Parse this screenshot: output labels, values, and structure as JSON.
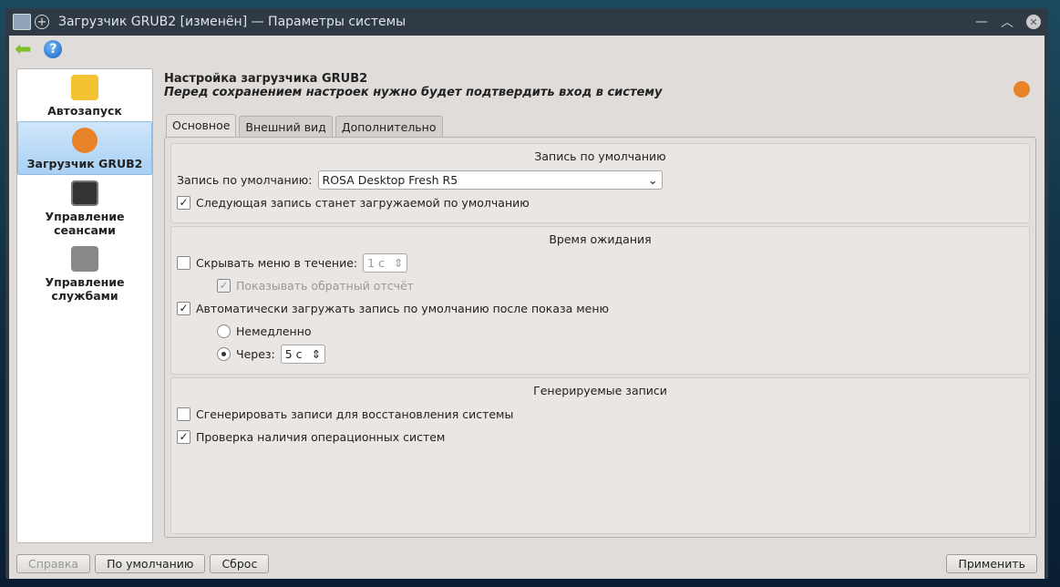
{
  "window": {
    "title": "Загрузчик GRUB2 [изменён] — Параметры системы"
  },
  "sidebar": {
    "items": [
      {
        "label": "Автозапуск"
      },
      {
        "label": "Загрузчик GRUB2"
      },
      {
        "label": "Управление сеансами"
      },
      {
        "label": "Управление службами"
      }
    ]
  },
  "header": {
    "title": "Настройка загрузчика GRUB2",
    "subtitle": "Перед сохранением настроек нужно будет подтвердить вход в систему"
  },
  "tabs": [
    "Основное",
    "Внешний вид",
    "Дополнительно"
  ],
  "default": {
    "title": "Запись по умолчанию",
    "label": "Запись по умолчанию:",
    "value": "ROSA Desktop Fresh R5",
    "next": "Следующая запись станет загружаемой по умолчанию"
  },
  "timeout": {
    "title": "Время ожидания",
    "hide": "Скрывать меню в течение:",
    "hide_value": "1 с",
    "countdown": "Показывать обратный отсчёт",
    "auto": "Автоматически загружать запись по умолчанию после показа меню",
    "now": "Немедленно",
    "after": "Через:",
    "after_value": "5 с"
  },
  "gen": {
    "title": "Генерируемые записи",
    "recovery": "Сгенерировать записи для восстановления системы",
    "osprober": "Проверка наличия операционных систем"
  },
  "buttons": {
    "help": "Справка",
    "defaults": "По умолчанию",
    "reset": "Сброс",
    "apply": "Применить"
  }
}
